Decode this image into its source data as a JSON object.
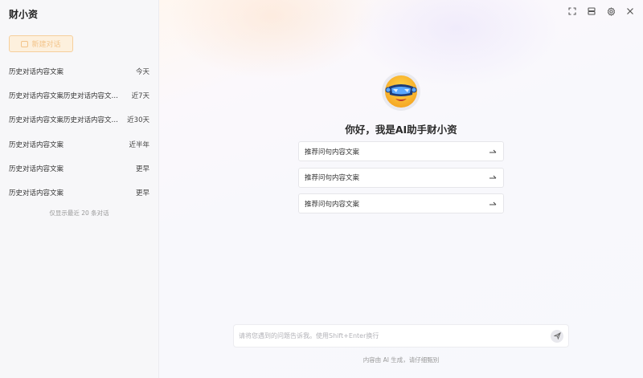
{
  "sidebar": {
    "app_title": "财小资",
    "new_chat_label": "新建对话",
    "history": [
      {
        "title": "历史对话内容文案",
        "date": "今天"
      },
      {
        "title": "历史对话内容文案历史对话内容文案...",
        "date": "近7天"
      },
      {
        "title": "历史对话内容文案历史对话内容文案...",
        "date": "近30天"
      },
      {
        "title": "历史对话内容文案",
        "date": "近半年"
      },
      {
        "title": "历史对话内容文案",
        "date": "更早"
      },
      {
        "title": "历史对话内容文案",
        "date": "更早"
      }
    ],
    "history_note": "仅显示最近 20 条对话"
  },
  "header": {
    "icons": [
      "fullscreen-icon",
      "layout-icon",
      "settings-icon",
      "close-icon"
    ]
  },
  "main": {
    "avatar_icon": "ai-assistant-avatar-icon",
    "greeting": "你好，我是AI助手财小资",
    "suggestions": [
      {
        "label": "推荐问句内容文案"
      },
      {
        "label": "推荐问句内容文案"
      },
      {
        "label": "推荐问句内容文案"
      }
    ]
  },
  "input": {
    "value": "",
    "placeholder": "请将您遇到的问题告诉我。使用Shift+Enter换行"
  },
  "footer": {
    "disclaimer": "内容由 AI 生成，请仔细甄别"
  },
  "colors": {
    "accent_orange": "#f3c48a",
    "accent_orange_bg": "#fdf0dd",
    "sidebar_bg": "#f7f7f9"
  }
}
